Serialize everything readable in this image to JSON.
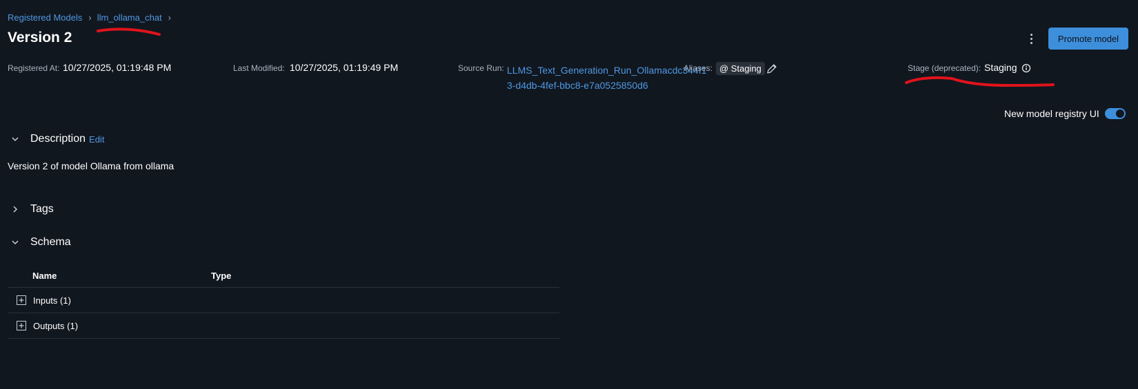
{
  "breadcrumb": {
    "root": "Registered Models",
    "model": "llm_ollama_chat"
  },
  "page": {
    "title": "Version 2"
  },
  "actions": {
    "promote_label": "Promote model",
    "menu_icon": "kebab-menu-icon"
  },
  "meta": {
    "registered_at_label": "Registered At:",
    "registered_at_value": "10/27/2025, 01:19:48 PM",
    "last_modified_label": "Last Modified:",
    "last_modified_value": "10/27/2025, 01:19:49 PM",
    "source_run_label": "Source Run:",
    "source_run_value": "LLMS_Text_Generation_Run_Ollamacdc344f13-d4db-4fef-bbc8-e7a0525850d6",
    "aliases_label": "Aliases:",
    "alias_value": "@ Staging",
    "stage_label": "Stage (deprecated):",
    "stage_value": "Staging"
  },
  "toggle": {
    "label": "New model registry UI",
    "enabled": true
  },
  "description": {
    "header": "Description",
    "edit_label": "Edit",
    "text": "Version 2 of model Ollama from ollama"
  },
  "tags": {
    "header": "Tags"
  },
  "schema": {
    "header": "Schema",
    "columns": [
      "Name",
      "Type"
    ],
    "rows": [
      {
        "name": "Inputs (1)"
      },
      {
        "name": "Outputs (1)"
      }
    ]
  },
  "colors": {
    "background": "#11171f",
    "link": "#4f98e3",
    "primary_button": "#3d8fdb",
    "annotation": "#e0131b"
  }
}
